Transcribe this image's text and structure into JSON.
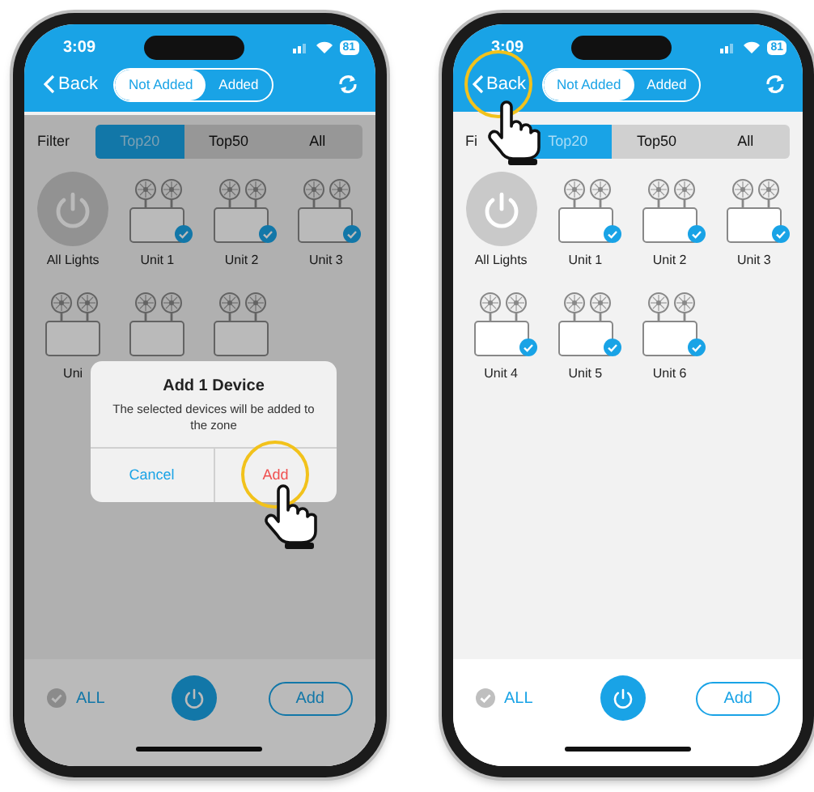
{
  "phones": [
    {
      "status": {
        "time": "3:09",
        "battery": "81"
      },
      "back": "Back",
      "back_tapped": false,
      "segments": [
        {
          "label": "Not Added",
          "selected": true
        },
        {
          "label": "Added",
          "selected": false
        }
      ],
      "filter": {
        "label": "Filter",
        "options": [
          {
            "label": "Top20",
            "selected": true
          },
          {
            "label": "Top50",
            "selected": false
          },
          {
            "label": "All",
            "selected": false
          }
        ]
      },
      "devices": [
        {
          "kind": "all",
          "label": "All Lights"
        },
        {
          "kind": "unit",
          "label": "Unit 1",
          "checked": true
        },
        {
          "kind": "unit",
          "label": "Unit 2",
          "checked": true
        },
        {
          "kind": "unit",
          "label": "Unit 3",
          "checked": true
        },
        {
          "kind": "unit",
          "label": "Uni",
          "checked": false
        },
        {
          "kind": "unit",
          "checked": false
        },
        {
          "kind": "unit",
          "checked": false
        }
      ],
      "bottom": {
        "all_label": "ALL",
        "add_label": "Add"
      },
      "dimmed": true,
      "dialog": {
        "title": "Add 1 Device",
        "message": "The selected devices will be added to the zone",
        "buttons": [
          {
            "kind": "cancel",
            "label": "Cancel",
            "tapped": false
          },
          {
            "kind": "confirm",
            "label": "Add",
            "tapped": true
          }
        ]
      }
    },
    {
      "status": {
        "time": "3:09",
        "battery": "81"
      },
      "back": "Back",
      "back_tapped": true,
      "segments": [
        {
          "label": "Not Added",
          "selected": true
        },
        {
          "label": "Added",
          "selected": false
        }
      ],
      "filter": {
        "label": "Fi",
        "options": [
          {
            "label": "Top20",
            "selected": true
          },
          {
            "label": "Top50",
            "selected": false
          },
          {
            "label": "All",
            "selected": false
          }
        ]
      },
      "devices": [
        {
          "kind": "all",
          "label": "All Lights"
        },
        {
          "kind": "unit",
          "label": "Unit 1",
          "checked": true
        },
        {
          "kind": "unit",
          "label": "Unit 2",
          "checked": true
        },
        {
          "kind": "unit",
          "label": "Unit 3",
          "checked": true
        },
        {
          "kind": "unit",
          "label": "Unit 4",
          "checked": true
        },
        {
          "kind": "unit",
          "label": "Unit 5",
          "checked": true
        },
        {
          "kind": "unit",
          "label": "Unit 6",
          "checked": true
        }
      ],
      "bottom": {
        "all_label": "ALL",
        "add_label": "Add"
      },
      "dimmed": false
    }
  ]
}
